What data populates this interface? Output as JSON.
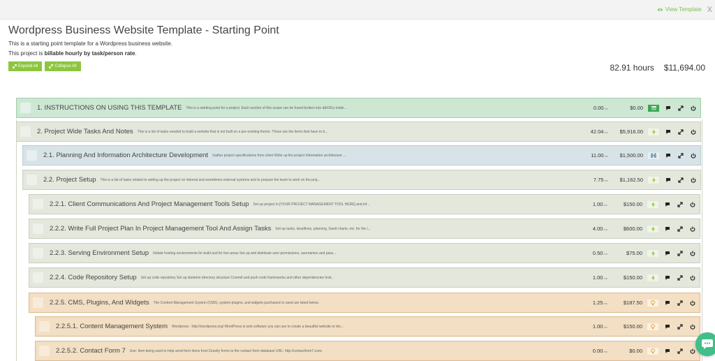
{
  "topbar": {
    "view_template": "View Template",
    "close": "X"
  },
  "project": {
    "title": "Wordpress Business Website Template - Starting Point",
    "description": "This is a starting point template for a Wordpress business website.",
    "billing_prefix": "This project is ",
    "billing_bold": "billable hourly by task/person rate",
    "billing_suffix": "."
  },
  "buttons": {
    "expand_all": "Expand All",
    "collapse_all": "Collapse All"
  },
  "totals": {
    "hours": "82.91 hours",
    "amount": "$11,694.00"
  },
  "hours_unit": "hrs",
  "rows": [
    {
      "name": "1. INSTRUCTIONS ON USING THIS TEMPLATE",
      "desc": "This is a starting point for a project. Each section of this scope can be found broken into it&#39;s indivi...",
      "hours": "0.00",
      "amount": "$0.00",
      "status": "complete"
    },
    {
      "name": "2. Project Wide Tasks And Notes",
      "desc": "This is a list of tasks needed to build a website that is not built on a pre-existing theme. These are the items that have to b...",
      "hours": "42.04",
      "amount": "$5,916.00",
      "status": "in-progress"
    },
    {
      "name": "2.1. Planning And Information Architecture Development",
      "desc": "Gather project specifications from client Write up the project information architecture ...",
      "hours": "11.00",
      "amount": "$1,500.00",
      "status": "review"
    },
    {
      "name": "2.2. Project Setup",
      "desc": "This is a list of tasks related to setting up the project on internal and sometimes external systems and to prepare the team to work on the proj...",
      "hours": "7.75",
      "amount": "$1,162.50",
      "status": "in-progress"
    },
    {
      "name": "2.2.1. Client Communications And Project Management Tools Setup",
      "desc": "Set up project in [YOUR PROJECT MANAGEMENT TOOL HERE] and inf...",
      "hours": "1.00",
      "amount": "$150.00",
      "status": "in-progress"
    },
    {
      "name": "2.2.2. Write Full Project Plan In Project Management Tool And Assign Tasks",
      "desc": "Set up tasks, deadlines, planning, Gantt charts, etc. for the i...",
      "hours": "4.00",
      "amount": "$600.00",
      "status": "in-progress"
    },
    {
      "name": "2.2.3. Serving Environment Setup",
      "desc": "Initiate hosting environments for build and for live areas Set up and distribute user permissions, usernames and pass...",
      "hours": "0.50",
      "amount": "$75.00",
      "status": "in-progress"
    },
    {
      "name": "2.2.4. Code Repository Setup",
      "desc": "Set up code repository Set up skeleton directory structure Commit and push code frameworks and other dependencies Invit...",
      "hours": "1.00",
      "amount": "$150.00",
      "status": "in-progress"
    },
    {
      "name": "2.2.5. CMS, Plugins, And Widgets",
      "desc": "The Content Management System (CMS), system plugins, and widgets purchased or used are listed below.",
      "hours": "1.25",
      "amount": "$187.50",
      "status": "idea"
    },
    {
      "name": "2.2.5.1. Content Management System",
      "desc": "Wordpress - http://wordpress.org/ WordPress is web software you can use to create a beautiful website or blo...",
      "hours": "1.00",
      "amount": "$150.00",
      "status": "idea"
    },
    {
      "name": "2.2.5.2. Contact Form 7",
      "desc": "Use: Item being used to help send form items from Gravity forms to the contact form database URL: http://contactform7.com/",
      "hours": "0.00",
      "amount": "$0.00",
      "status": "idea"
    }
  ]
}
